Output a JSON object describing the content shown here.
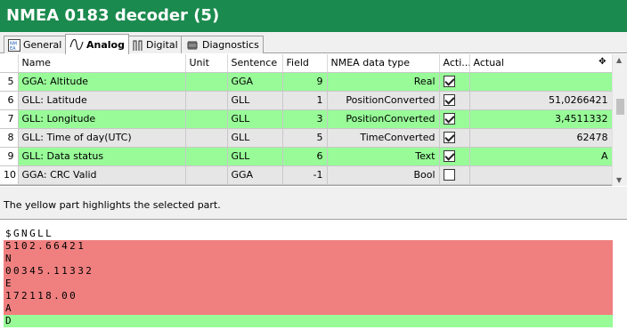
{
  "title": "NMEA 0183 decoder (5)",
  "tabs": [
    {
      "label": "General",
      "icon": "nmea-icon"
    },
    {
      "label": "Analog",
      "icon": "wave-icon"
    },
    {
      "label": "Digital",
      "icon": "digital-pulse-icon"
    },
    {
      "label": "Diagnostics",
      "icon": "chip-icon"
    }
  ],
  "table": {
    "columns": [
      "Name",
      "Unit",
      "Sentence",
      "Field",
      "NMEA data type",
      "Acti...",
      "Actual"
    ],
    "sort_icon": "move-icon",
    "rows": [
      {
        "num": "5",
        "name": "GGA: Altitude",
        "unit": "",
        "sentence": "GGA",
        "field": "9",
        "type": "Real",
        "active": true,
        "actual": "",
        "color": "green"
      },
      {
        "num": "6",
        "name": "GLL: Latitude",
        "unit": "",
        "sentence": "GLL",
        "field": "1",
        "type": "PositionConverted",
        "active": true,
        "actual": "51,0266421",
        "color": "gray"
      },
      {
        "num": "7",
        "name": "GLL: Longitude",
        "unit": "",
        "sentence": "GLL",
        "field": "3",
        "type": "PositionConverted",
        "active": true,
        "actual": "3,4511332",
        "color": "green"
      },
      {
        "num": "8",
        "name": "GLL: Time of day(UTC)",
        "unit": "",
        "sentence": "GLL",
        "field": "5",
        "type": "TimeConverted",
        "active": true,
        "actual": "62478",
        "color": "gray"
      },
      {
        "num": "9",
        "name": "GLL: Data status",
        "unit": "",
        "sentence": "GLL",
        "field": "6",
        "type": "Text",
        "active": true,
        "actual": "A",
        "color": "green"
      },
      {
        "num": "10",
        "name": "GGA: CRC Valid",
        "unit": "",
        "sentence": "GGA",
        "field": "-1",
        "type": "Bool",
        "active": false,
        "actual": "",
        "color": "gray"
      }
    ]
  },
  "hint": "The yellow part highlights the selected part.",
  "decoded_lines": [
    {
      "text": "$GNGLL",
      "color": "none"
    },
    {
      "text": "5102.66421",
      "color": "red"
    },
    {
      "text": "N",
      "color": "red"
    },
    {
      "text": "00345.11332",
      "color": "red"
    },
    {
      "text": "E",
      "color": "red"
    },
    {
      "text": "172118.00",
      "color": "red"
    },
    {
      "text": "A",
      "color": "red"
    },
    {
      "text": "D",
      "color": "green"
    }
  ],
  "colors": {
    "title_bg": "#1b8a4e",
    "row_green": "#98fb98",
    "row_gray": "#e6e6e6",
    "highlight_red": "#f08080"
  }
}
